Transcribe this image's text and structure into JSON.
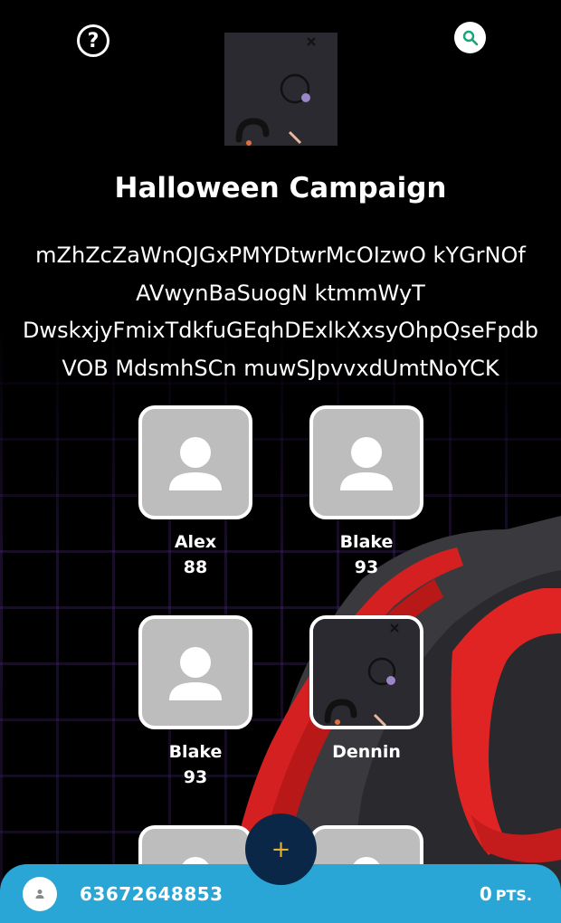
{
  "header": {
    "help_icon": "question-circle-icon",
    "search_icon": "search-icon"
  },
  "campaign": {
    "title": "Halloween Campaign",
    "description_lines": [
      "mZhZcZaWnQJGxPMYDtwrMcOIzwO kYGrNOf",
      "AVwynBaSuogN ktmmWyT",
      "DwskxjyFmixTdkfuGEqhDExlkXxsyOhpQseFpdb",
      "VOB MdsmhSCn muwSJpvvxdUmtNoYCK"
    ]
  },
  "players": [
    {
      "name": "Alex",
      "score": "88",
      "avatar": "default"
    },
    {
      "name": "Blake",
      "score": "93",
      "avatar": "default"
    },
    {
      "name": "Blake",
      "score": "93",
      "avatar": "default"
    },
    {
      "name": "Dennin",
      "score": "",
      "avatar": "image"
    },
    {
      "name": "",
      "score": "",
      "avatar": "default"
    },
    {
      "name": "",
      "score": "",
      "avatar": "default"
    }
  ],
  "fab": {
    "label": "+"
  },
  "footer": {
    "phone": "63672648853",
    "points_value": "0",
    "points_unit": "PTS."
  },
  "colors": {
    "bottom_bar": "#2aa6d6",
    "fab_bg": "#0b2747",
    "fab_icon": "#e8b030",
    "avatar_placeholder": "#bdbdbd",
    "search_icon": "#1aa37a"
  }
}
